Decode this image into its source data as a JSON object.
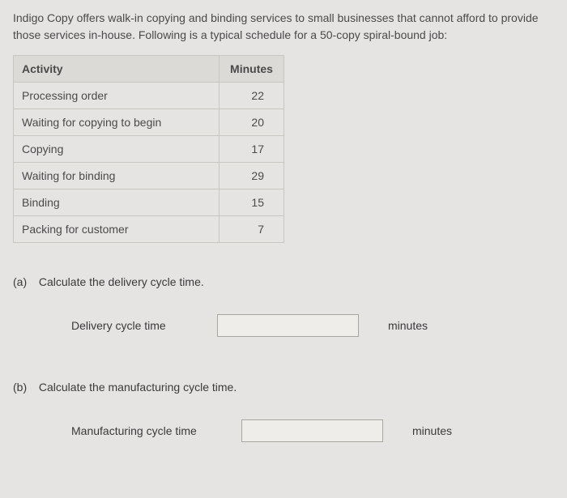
{
  "intro": "Indigo Copy offers walk-in copying and binding services to small businesses that cannot afford to provide those services in-house. Following is a typical schedule for a 50-copy spiral-bound job:",
  "table": {
    "headers": {
      "activity": "Activity",
      "minutes": "Minutes"
    },
    "rows": [
      {
        "activity": "Processing order",
        "minutes": "22"
      },
      {
        "activity": "Waiting for copying to begin",
        "minutes": "20"
      },
      {
        "activity": "Copying",
        "minutes": "17"
      },
      {
        "activity": "Waiting for binding",
        "minutes": "29"
      },
      {
        "activity": "Binding",
        "minutes": "15"
      },
      {
        "activity": "Packing for customer",
        "minutes": "7"
      }
    ]
  },
  "qa": {
    "a": {
      "marker": "(a)",
      "prompt": "Calculate the delivery cycle time.",
      "answer_label": "Delivery cycle time",
      "unit": "minutes",
      "value": ""
    },
    "b": {
      "marker": "(b)",
      "prompt": "Calculate the manufacturing cycle time.",
      "answer_label": "Manufacturing cycle time",
      "unit": "minutes",
      "value": ""
    }
  }
}
